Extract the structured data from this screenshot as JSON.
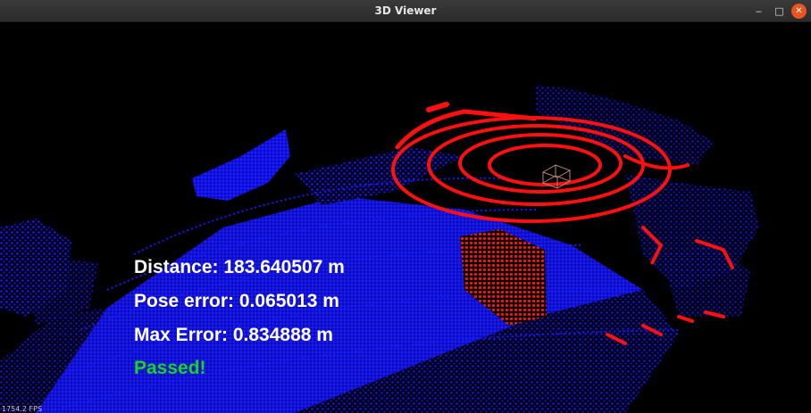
{
  "window": {
    "title": "3D Viewer",
    "controls": {
      "minimize": "‒",
      "maximize": "□",
      "close": "✕"
    }
  },
  "overlay": {
    "distance": "Distance: 183.640507 m",
    "pose_error": "Pose error: 0.065013 m",
    "max_error": "Max Error: 0.834888 m",
    "status": "Passed!"
  },
  "fps": "1754.2 FPS",
  "colors": {
    "map_cloud": "#1414ff",
    "scan_cloud": "#ff1010",
    "pose_box": "#b9857a",
    "passed_text": "#19d419",
    "background": "#000000"
  }
}
